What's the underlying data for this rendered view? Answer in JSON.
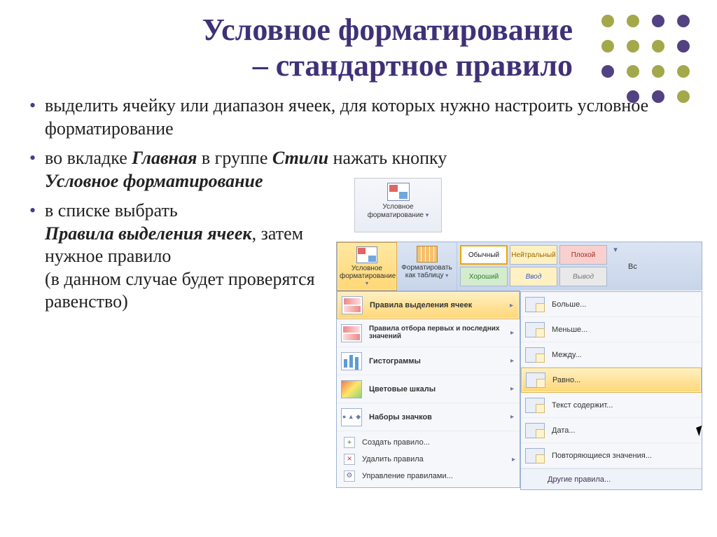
{
  "title_line1": "Условное форматирование",
  "title_line2": "– стандартное правило",
  "bullets": {
    "b1": "выделить ячейку или диапазон ячеек, для которых нужно настроить условное форматирование",
    "b2_pre": "во вкладке ",
    "b2_b1": "Главная",
    "b2_mid": " в группе ",
    "b2_b2": "Стили",
    "b2_post": " нажать кнопку ",
    "b2_b3": "Условное форматирование",
    "b3_pre": "в списке выбрать ",
    "b3_b1": "Правила выделения ячеек",
    "b3_post1": ", затем нужное правило",
    "b3_post2": "(в данном случае будет проверятся равенство)"
  },
  "ribbon_button": {
    "line1": "Условное",
    "line2": "форматирование",
    "drop": "▾"
  },
  "ribbon": {
    "cond_l1": "Условное",
    "cond_l2": "форматирование",
    "table_l1": "Форматировать",
    "table_l2": "как таблицу",
    "drop": "▾",
    "styles": {
      "normal": "Обычный",
      "neutral": "Нейтральный",
      "bad": "Плохой",
      "good": "Хороший",
      "input": "Ввод",
      "output": "Вывод"
    },
    "tail": "Вс"
  },
  "menu1": {
    "i1": "Правила выделения ячеек",
    "i2": "Правила отбора первых и последних значений",
    "i3": "Гистограммы",
    "i4": "Цветовые шкалы",
    "i5": "Наборы значков",
    "f1": "Создать правило...",
    "f2": "Удалить правила",
    "f3": "Управление правилами..."
  },
  "menu2": {
    "i1": "Больше...",
    "i2": "Меньше...",
    "i3": "Между...",
    "i4": "Равно...",
    "i5": "Текст содержит...",
    "i6": "Дата...",
    "i7": "Повторяющиеся значения...",
    "foot": "Другие правила..."
  },
  "arrow": "▸"
}
